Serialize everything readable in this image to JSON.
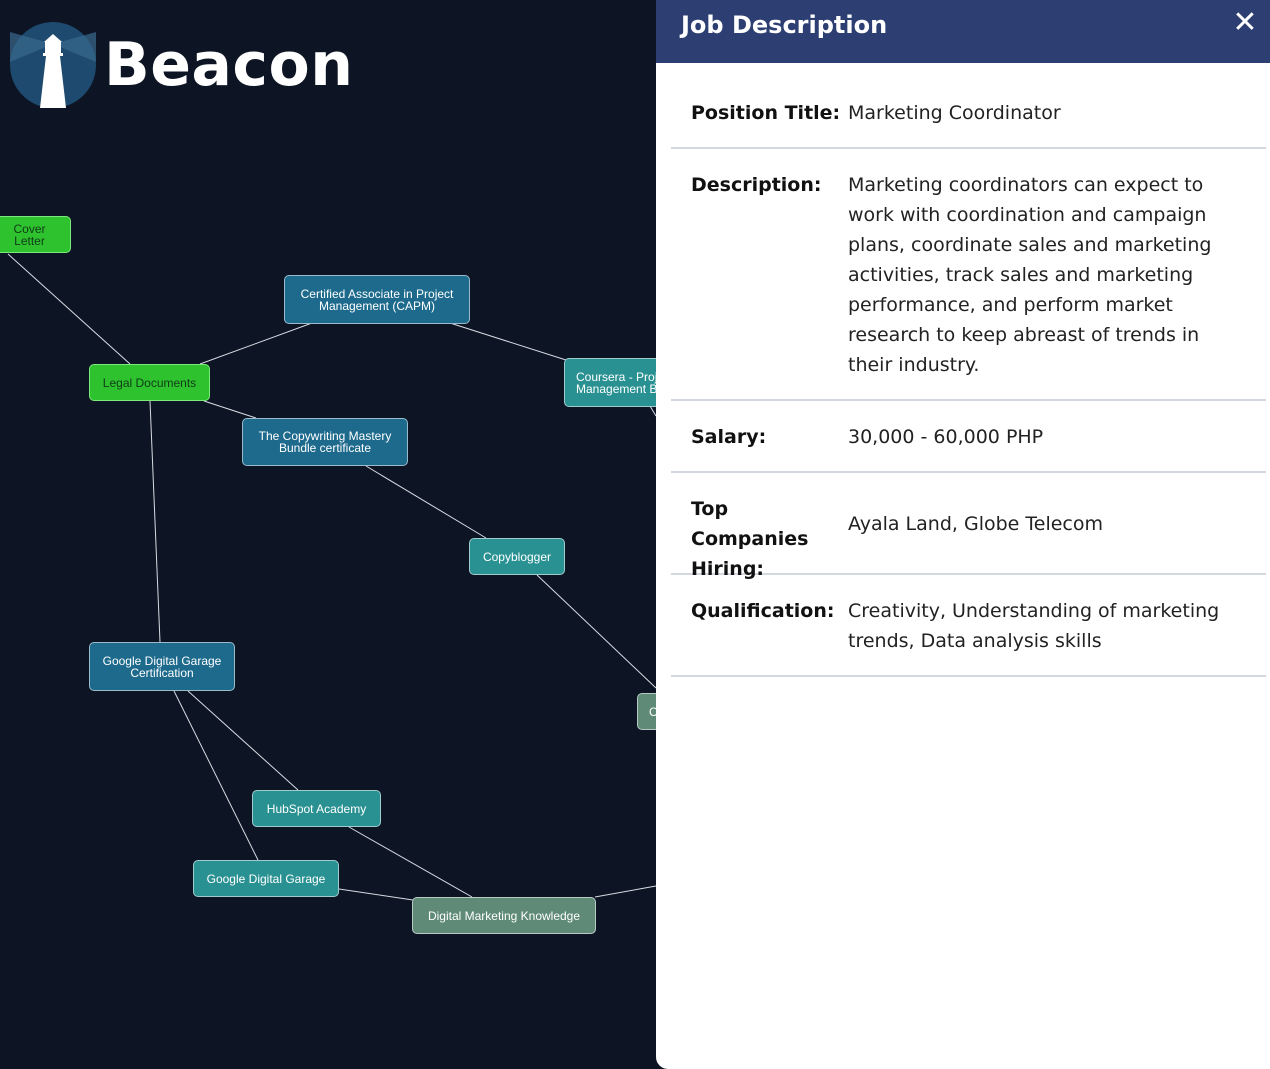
{
  "app": {
    "name": "Beacon"
  },
  "graph": {
    "nodes": [
      {
        "id": "cover-letter",
        "label": "Cover Letter",
        "color": "green"
      },
      {
        "id": "capm",
        "label": "Certified Associate in Project\nManagement (CAPM)",
        "color": "blue"
      },
      {
        "id": "coursera",
        "label": "Coursera - Project\nManagement Basics",
        "color": "teal"
      },
      {
        "id": "legal",
        "label": "Legal Documents",
        "color": "green"
      },
      {
        "id": "copywriting",
        "label": "The Copywriting Mastery\nBundle certificate",
        "color": "blue"
      },
      {
        "id": "copyblogger",
        "label": "Copyblogger",
        "color": "teal"
      },
      {
        "id": "gdg-cert",
        "label": "Google Digital Garage\nCertification",
        "color": "blue"
      },
      {
        "id": "hidden-c",
        "label": "C",
        "color": "gray"
      },
      {
        "id": "hubspot",
        "label": "HubSpot Academy",
        "color": "teal"
      },
      {
        "id": "gdg",
        "label": "Google Digital Garage",
        "color": "teal"
      },
      {
        "id": "dmk",
        "label": "Digital Marketing Knowledge",
        "color": "gray"
      }
    ]
  },
  "panel": {
    "title": "Job Description",
    "close_icon": "close-icon",
    "rows": [
      {
        "label": "Position Title:",
        "value": "Marketing Coordinator"
      },
      {
        "label": "Description:",
        "value": "Marketing coordinators can expect to work with coordination and campaign plans, coordinate sales and marketing activities, track sales and marketing performance, and perform market research to keep abreast of trends in their industry."
      },
      {
        "label": "Salary:",
        "value": "30,000 - 60,000 PHP"
      },
      {
        "label": "Top Companies Hiring:",
        "value": "Ayala Land, Globe Telecom"
      },
      {
        "label": "Qualification:",
        "value": "Creativity, Understanding of marketing trends, Data analysis skills"
      }
    ]
  },
  "colors": {
    "background": "#0d1424",
    "header": "#2c3e72",
    "node_green": "#2ec22e",
    "node_blue": "#1d6a8c",
    "node_teal": "#2a9192",
    "node_gray": "#5f8a78"
  }
}
